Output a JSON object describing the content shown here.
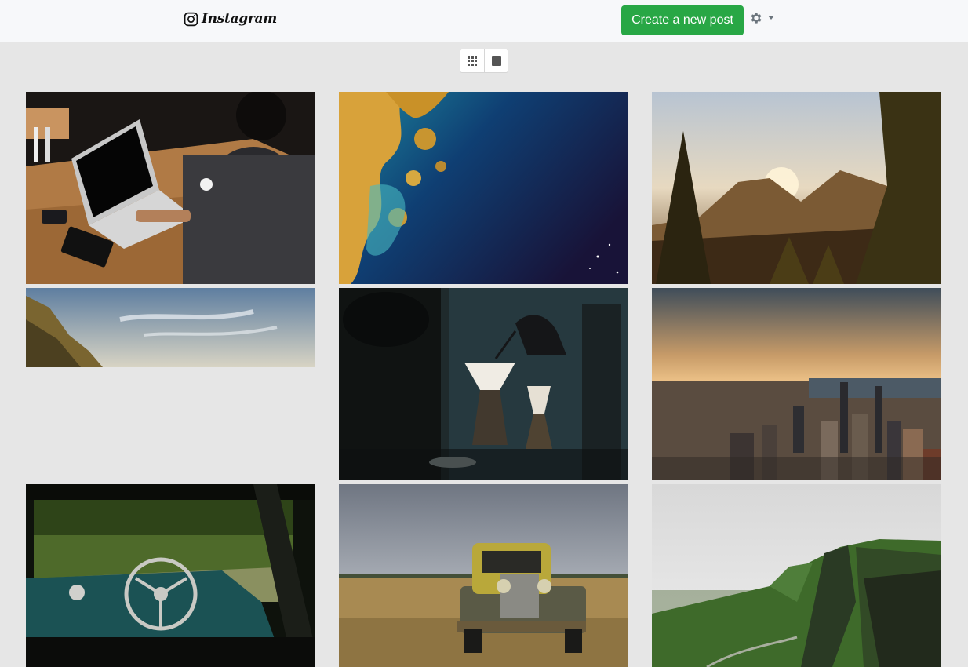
{
  "navbar": {
    "brand": "Instagram",
    "brand_icon": "instagram-icon",
    "create_post_label": "Create a new post",
    "settings_icon": "gear-icon",
    "dropdown_icon": "caret-down-icon"
  },
  "view_toggle": {
    "options": [
      "grid-icon",
      "square-icon"
    ]
  },
  "colors": {
    "navbar_bg": "#f7f8fa",
    "page_bg": "#e6e6e6",
    "create_button": "#28a745"
  },
  "posts": [
    {
      "subject": "laptop-desk"
    },
    {
      "subject": "aerial-coastline"
    },
    {
      "subject": "forest-sunset"
    },
    {
      "subject": "cliff-sky"
    },
    {
      "subject": "coffee-pour-over"
    },
    {
      "subject": "city-skyline-sunset"
    },
    {
      "subject": "car-interior"
    },
    {
      "subject": "rusty-truck-field"
    },
    {
      "subject": "green-hills"
    }
  ]
}
